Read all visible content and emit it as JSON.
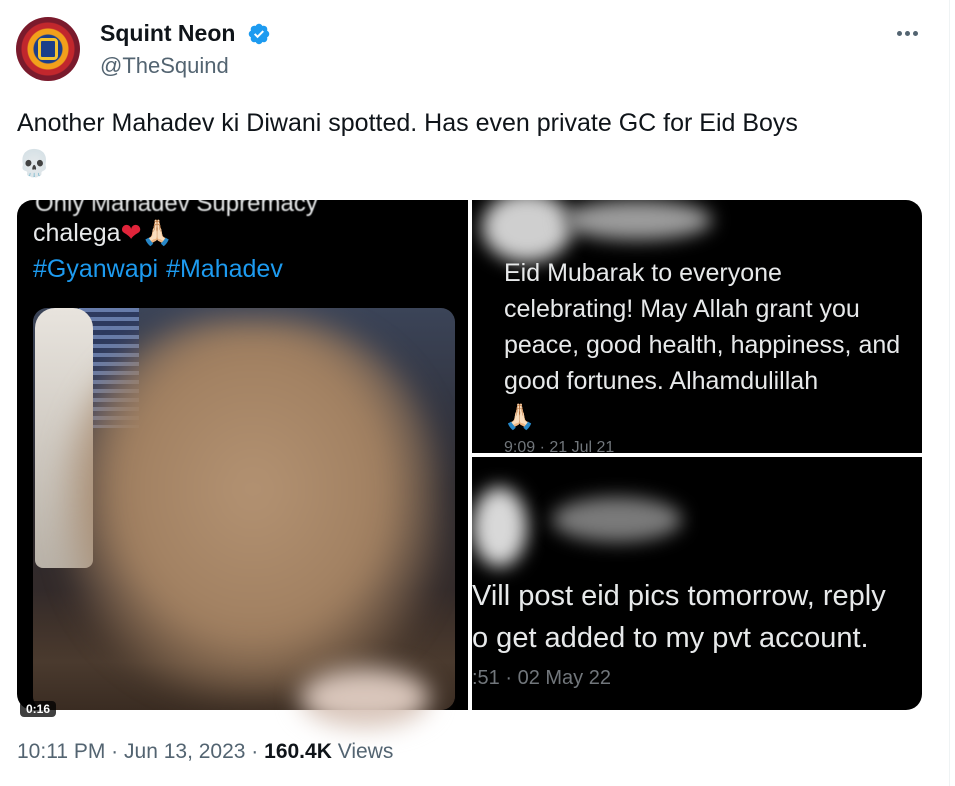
{
  "author": {
    "display_name": "Squint Neon",
    "handle": "@TheSquind",
    "verified": true
  },
  "tweet": {
    "text": "Another Mahadev ki Diwani spotted. Has even private GC for Eid Boys",
    "emoji": "💀"
  },
  "media": {
    "left_panel": {
      "cut_line": "Only Mahadev Supremacy",
      "line": "chalega",
      "emojis": [
        "❤",
        "🙏🏻"
      ],
      "hashtags": [
        "#Gyanwapi",
        "#Mahadev"
      ],
      "video_duration": "0:16"
    },
    "top_right_panel": {
      "text": "Eid Mubarak to everyone celebrating! May Allah grant you peace, good health, happiness, and good fortunes. Alhamdulillah",
      "emoji": "🙏🏻",
      "timestamp": "9:09 · 21 Jul 21"
    },
    "bottom_right_panel": {
      "line1": "Vill post eid pics tomorrow, reply",
      "line2": "o get added to my pvt account.",
      "timestamp": ":51 · 02 May 22"
    }
  },
  "footer": {
    "time": "10:11 PM",
    "separator": "·",
    "date": "Jun 13, 2023",
    "views_count": "160.4K",
    "views_label": "Views"
  },
  "colors": {
    "link_blue": "#1d9bf0",
    "secondary_text": "#536471",
    "verified_blue": "#1d9bf0"
  }
}
